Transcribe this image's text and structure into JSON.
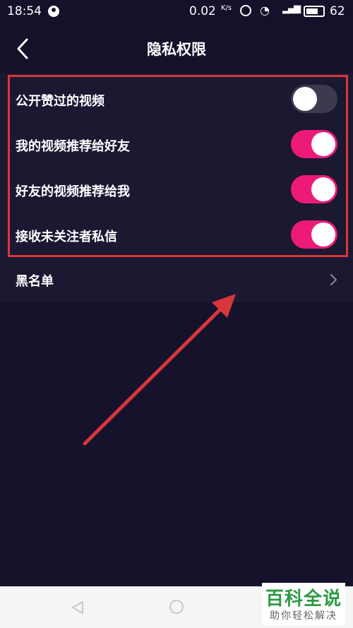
{
  "status_bar": {
    "time": "18:54",
    "network_speed": "0.02",
    "speed_unit": "K/s",
    "battery": "62"
  },
  "nav": {
    "title": "隐私权限"
  },
  "settings": [
    {
      "label": "公开赞过的视频",
      "state": "off"
    },
    {
      "label": "我的视频推荐给好友",
      "state": "on"
    },
    {
      "label": "好友的视频推荐给我",
      "state": "on"
    },
    {
      "label": "接收未关注者私信",
      "state": "on"
    }
  ],
  "blacklist": {
    "label": "黑名单"
  },
  "watermark": {
    "title": "百科全说",
    "subtitle": "助你轻松解决"
  },
  "colors": {
    "accent": "#ee1a7a",
    "background": "#16122b",
    "highlight": "#d9353d"
  }
}
